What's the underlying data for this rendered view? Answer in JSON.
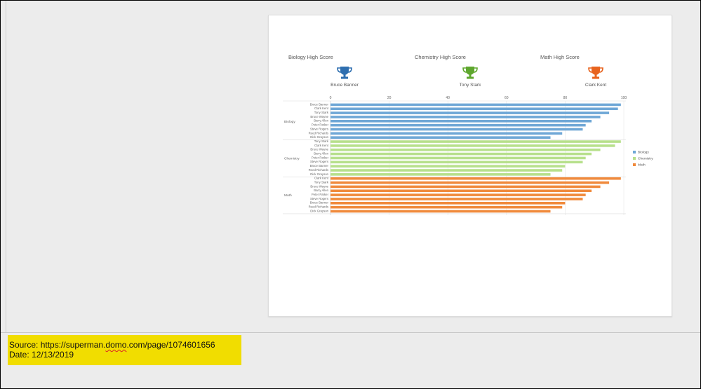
{
  "highscores": [
    {
      "title": "Biology High Score",
      "winner": "Bruce Banner",
      "color": "#2f6fb0"
    },
    {
      "title": "Chemistry High Score",
      "winner": "Tony Stark",
      "color": "#5ea72e"
    },
    {
      "title": "Math High Score",
      "winner": "Clark Kent",
      "color": "#e8641f"
    }
  ],
  "source": {
    "prefix": "Source: https://superman.",
    "underlined": "domo",
    "suffix": ".com/page/1074601656",
    "date_line": "Date: 12/13/2019"
  },
  "chart_data": {
    "type": "bar",
    "orientation": "horizontal",
    "xlim": [
      0,
      100
    ],
    "xticks": [
      "0",
      "20",
      "40",
      "60",
      "80",
      "100"
    ],
    "grid": true,
    "legend_position": "right",
    "groups": [
      {
        "name": "Biology",
        "color": "#6fa7d6",
        "categories": [
          "Bruce Banner",
          "Clark Kent",
          "Tony Stark",
          "Bruce Wayne",
          "Barry Allen",
          "Peter Parker",
          "Steve Rogers",
          "Reed Richards",
          "Dick Grayson"
        ],
        "values": [
          99,
          98,
          95,
          92,
          89,
          87,
          86,
          79,
          75
        ]
      },
      {
        "name": "Chemistry",
        "color": "#b7e08c",
        "categories": [
          "Tony Stark",
          "Clark Kent",
          "Bruce Wayne",
          "Barry Allen",
          "Peter Parker",
          "Steve Rogers",
          "Bruce Banner",
          "Reed Richards",
          "Dick Grayson"
        ],
        "values": [
          99,
          97,
          92,
          89,
          87,
          86,
          80,
          79,
          75
        ]
      },
      {
        "name": "Math",
        "color": "#f08a3c",
        "categories": [
          "Clark Kent",
          "Tony Stark",
          "Bruce Wayne",
          "Barry Allen",
          "Peter Parker",
          "Steve Rogers",
          "Bruce Banner",
          "Reed Richards",
          "Dick Grayson"
        ],
        "values": [
          99,
          95,
          92,
          89,
          87,
          86,
          80,
          79,
          75
        ]
      }
    ],
    "legend": [
      {
        "name": "Biology",
        "color": "#6fa7d6"
      },
      {
        "name": "Chemistry",
        "color": "#b7e08c"
      },
      {
        "name": "Math",
        "color": "#f08a3c"
      }
    ]
  }
}
